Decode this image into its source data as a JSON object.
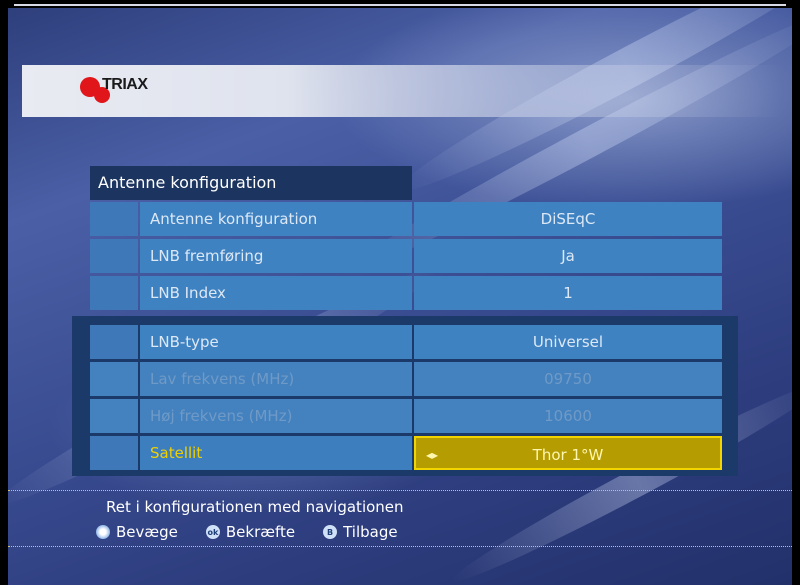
{
  "brand": {
    "logo_text": "TRIAX"
  },
  "panel": {
    "title": "Antenne konfiguration"
  },
  "rows": [
    {
      "label": "Antenne konfiguration",
      "value": "DiSEqC"
    },
    {
      "label": "LNB fremføring",
      "value": "Ja"
    },
    {
      "label": "LNB Index",
      "value": "1"
    },
    {
      "label": "LNB-type",
      "value": "Universel"
    },
    {
      "label": "Lav frekvens (MHz)",
      "value": "09750"
    },
    {
      "label": "Høj frekvens (MHz)",
      "value": "10600"
    },
    {
      "label": "Satellit",
      "value": "Thor 1°W",
      "arrows": "◂▸"
    }
  ],
  "footer": {
    "help_text": "Ret i konfigurationen med navigationen",
    "keys": [
      {
        "icon": "nav-icon",
        "glyph": "",
        "label": "Bevæge"
      },
      {
        "icon": "ok-icon",
        "glyph": "ok",
        "label": "Bekræfte"
      },
      {
        "icon": "back-icon",
        "glyph": "B",
        "label": "Tilbage"
      }
    ]
  },
  "colors": {
    "selected_fill": "#b59c00",
    "selected_border": "#f2d400",
    "selected_label": "#f0d000",
    "row_fill": "#3f82c2",
    "title_fill": "#1c3560"
  }
}
